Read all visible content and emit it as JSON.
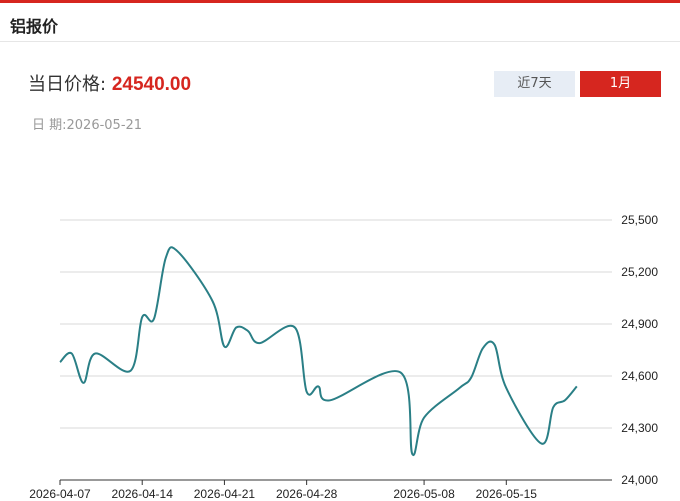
{
  "header": {
    "title": "铝报价"
  },
  "price": {
    "label": "当日价格:",
    "value": "24540.00"
  },
  "date": {
    "label": "日 期:",
    "value": "2026-05-21"
  },
  "range_buttons": {
    "week_label": "近7天",
    "month_label": "1月",
    "active": "1月"
  },
  "colors": {
    "accent": "#d6261f",
    "line": "#2a7f86",
    "grid": "#d9d9d9"
  },
  "chart_data": {
    "type": "line",
    "xlabel": "",
    "ylabel": "",
    "ylim": [
      24000,
      25500
    ],
    "y_ticks": [
      24000,
      24300,
      24600,
      24900,
      25200,
      25500
    ],
    "y_tick_labels": [
      "24,000",
      "24,300",
      "24,600",
      "24,900",
      "25,200",
      "25,500"
    ],
    "x_tick_labels": [
      "2026-04-07",
      "2026-04-14",
      "2026-04-21",
      "2026-04-28",
      "2026-05-08",
      "2026-05-15"
    ],
    "grid": true,
    "legend": "none",
    "series": [
      {
        "x": [
          "2026-04-07",
          "2026-04-08",
          "2026-04-09",
          "2026-04-10",
          "2026-04-13",
          "2026-04-14",
          "2026-04-15",
          "2026-04-16",
          "2026-04-17",
          "2026-04-20",
          "2026-04-21",
          "2026-04-22",
          "2026-04-23",
          "2026-04-24",
          "2026-04-27",
          "2026-04-28",
          "2026-04-29",
          "2026-04-30",
          "2026-05-06",
          "2026-05-07",
          "2026-05-08",
          "2026-05-11",
          "2026-05-12",
          "2026-05-13",
          "2026-05-14",
          "2026-05-15",
          "2026-05-18",
          "2026-05-19",
          "2026-05-20",
          "2026-05-21"
        ],
        "values": [
          24680,
          24730,
          24560,
          24730,
          24630,
          24940,
          24930,
          25280,
          25320,
          25030,
          24770,
          24880,
          24860,
          24790,
          24880,
          24510,
          24540,
          24460,
          24620,
          24150,
          24360,
          24530,
          24590,
          24760,
          24780,
          24530,
          24210,
          24420,
          24460,
          24540
        ]
      }
    ]
  }
}
